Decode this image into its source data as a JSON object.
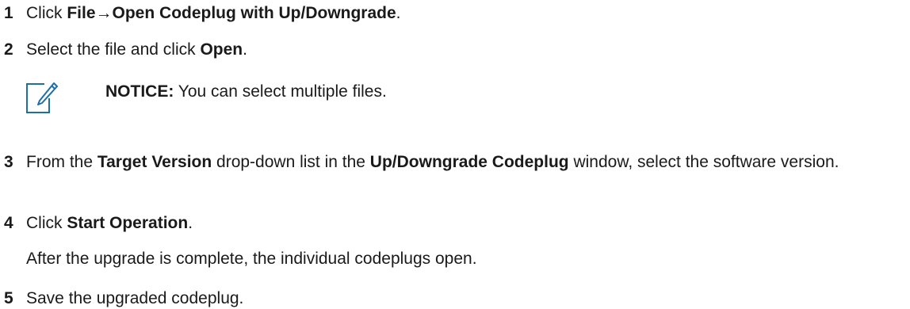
{
  "steps": [
    {
      "number": "1",
      "parts": [
        "Click ",
        "File→Open Codeplug with Up/Downgrade",
        "."
      ]
    },
    {
      "number": "2",
      "parts": [
        "Select the file and click ",
        "Open",
        "."
      ]
    },
    {
      "number": "3",
      "parts": [
        "From the ",
        "Target Version",
        " drop-down list in the ",
        "Up/Downgrade Codeplug",
        " window, select the software version."
      ]
    },
    {
      "number": "4",
      "parts": [
        "Click ",
        "Start Operation",
        "."
      ],
      "result": "After the upgrade is complete, the individual codeplugs open."
    },
    {
      "number": "5",
      "parts": [
        "Save the upgraded codeplug."
      ]
    }
  ],
  "notice": {
    "icon": "pencil-icon",
    "label": "NOTICE:",
    "text": " You can select multiple files."
  }
}
